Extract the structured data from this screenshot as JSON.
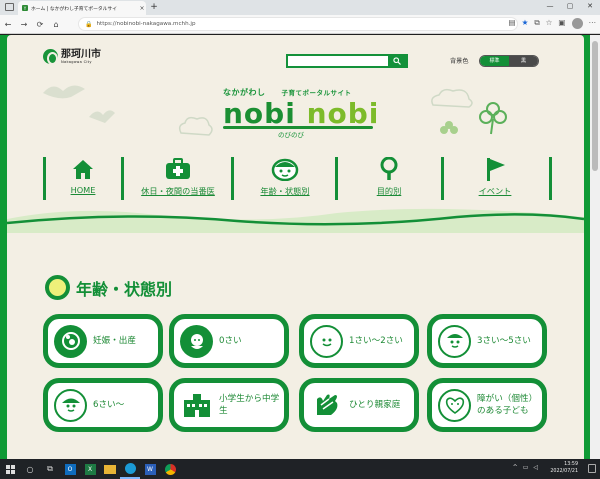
{
  "browser": {
    "tab_title": "ホーム | なかがわし子育てポータルサイ",
    "tab_favicon": "Y",
    "tab_close": "×",
    "new_tab": "+",
    "url": "https://nobinobi-nakagawa.mchh.jp",
    "controls": {
      "minimize": "—",
      "maximize": "▢",
      "close": "✕"
    },
    "nav": {
      "back": "←",
      "forward": "→",
      "reload": "⟳",
      "home": "⌂"
    },
    "icons": [
      "reader-icon",
      "favorite-star-icon",
      "collections-icon",
      "extensions-icon",
      "profile-icon",
      "more-icon"
    ]
  },
  "site": {
    "city_name": "那珂川市",
    "city_sub": "Nakagawa City",
    "bg_color_label": "背景色",
    "bg_standard": "標準",
    "bg_black": "黒",
    "tagline_left": "なかがわし",
    "tagline_right": "子育てポータルサイト",
    "logo_word1": "nobi",
    "logo_word2": "nobi",
    "logo_hiragana": "のびのび",
    "accent": "#138f37"
  },
  "menu": [
    {
      "label": "HOME",
      "icon": "house-icon"
    },
    {
      "label": "休日・夜間の当番医",
      "icon": "medical-kit-icon"
    },
    {
      "label": "年齢・状態別",
      "icon": "child-face-icon"
    },
    {
      "label": "目的別",
      "icon": "magnifier-icon"
    },
    {
      "label": "イベント",
      "icon": "flag-icon"
    }
  ],
  "section": {
    "title": "年齢・状態別"
  },
  "cards": [
    {
      "label": "妊娠・出産",
      "icon": "pregnancy-icon"
    },
    {
      "label": "0さい",
      "icon": "baby-icon"
    },
    {
      "label": "1さい～2さい",
      "icon": "toddler-icon"
    },
    {
      "label": "3さい～5さい",
      "icon": "child-icon"
    },
    {
      "label": "6さい～",
      "icon": "schoolchild-icon"
    },
    {
      "label": "小学生から中学生",
      "icon": "school-building-icon"
    },
    {
      "label": "ひとり親家庭",
      "icon": "hands-icon"
    },
    {
      "label": "障がい（個性）のある子ども",
      "icon": "heart-face-icon"
    }
  ],
  "taskbar": {
    "time": "13:59",
    "date": "2022/07/21",
    "apps": [
      "start-icon",
      "search-icon",
      "task-view-icon",
      "outlook-icon",
      "excel-icon",
      "file-explorer-icon",
      "edge-icon",
      "word-icon",
      "chrome-icon"
    ]
  }
}
